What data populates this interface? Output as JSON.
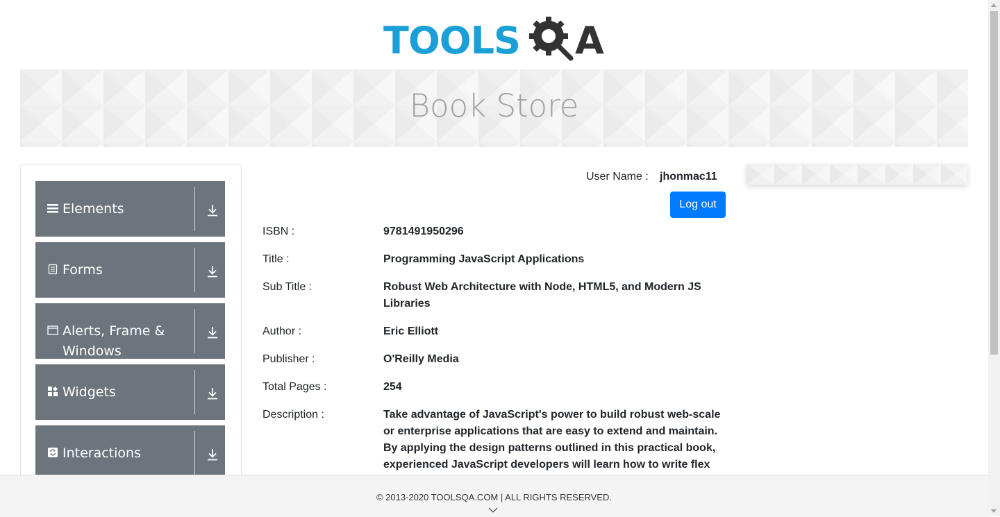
{
  "header": {
    "logo_text": "TOOLSQA",
    "logo_word": "TOOLS",
    "logo_end": "A"
  },
  "banner": {
    "title": "Book Store"
  },
  "sidebar": {
    "groups": [
      {
        "label": "Elements",
        "icon": "hamburger-icon"
      },
      {
        "label": "Forms",
        "icon": "document-icon"
      },
      {
        "label": "Alerts, Frame & Windows",
        "icon": "window-icon"
      },
      {
        "label": "Widgets",
        "icon": "widgets-icon"
      },
      {
        "label": "Interactions",
        "icon": "refresh-icon"
      }
    ]
  },
  "user": {
    "label": "User Name :",
    "value": "jhonmac11",
    "logout_label": "Log out"
  },
  "book": [
    {
      "key": "ISBN :",
      "value": "9781491950296"
    },
    {
      "key": "Title :",
      "value": "Programming JavaScript Applications"
    },
    {
      "key": "Sub Title :",
      "value": "Robust Web Architecture with Node, HTML5, and Modern JS Libraries"
    },
    {
      "key": "Author :",
      "value": "Eric Elliott"
    },
    {
      "key": "Publisher :",
      "value": "O'Reilly Media"
    },
    {
      "key": "Total Pages :",
      "value": "254"
    },
    {
      "key": "Description :",
      "value": "Take advantage of JavaScript's power to build robust web-scale or enterprise applications that are easy to extend and maintain. By applying the design patterns outlined in this practical book, experienced JavaScript developers will learn how to write flex"
    }
  ],
  "footer": {
    "text": "© 2013-2020 TOOLSQA.COM | ALL RIGHTS RESERVED."
  },
  "colors": {
    "brand_blue": "#1a9fd6",
    "sidebar_group": "#6c757d",
    "primary_button": "#007bff"
  }
}
